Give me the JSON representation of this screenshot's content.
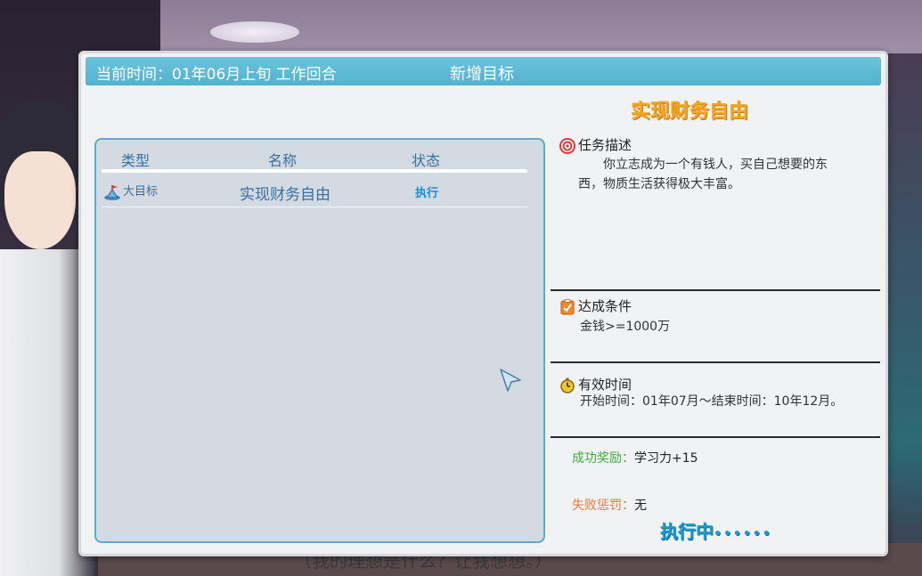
{
  "header": {
    "time_label": "当前时间：01年06月上旬 工作回合",
    "title": "新增目标"
  },
  "selected_goal_title": "实现财务自由",
  "list": {
    "columns": [
      "类型",
      "名称",
      "状态"
    ],
    "rows": [
      {
        "type": "大目标",
        "name": "实现财务自由",
        "status": "执行"
      }
    ]
  },
  "details": {
    "description_title": "任务描述",
    "description_text": "你立志成为一个有钱人，买自己想要的东西，物质生活获得极大丰富。",
    "condition_title": "达成条件",
    "condition_text": "金钱>=1000万",
    "time_title": "有效时间",
    "time_text": "开始时间：01年07月～结束时间：10年12月。",
    "reward_label": "成功奖励：",
    "reward_value": "学习力+15",
    "penalty_label": "失败惩罚：",
    "penalty_value": "无",
    "status_text": "执行中",
    "status_dots": "••••••"
  },
  "subtitle": "（我的理想是什么？让我想想。）",
  "colors": {
    "header_bg": "#5ab8d5",
    "goal_title": "#f5a623",
    "reward": "#3fae3f",
    "penalty": "#f0763a",
    "status": "#1b9bd1"
  },
  "icons": [
    "flag-icon",
    "target-icon",
    "checklist-icon",
    "stopwatch-icon",
    "cursor-arrow-icon"
  ]
}
